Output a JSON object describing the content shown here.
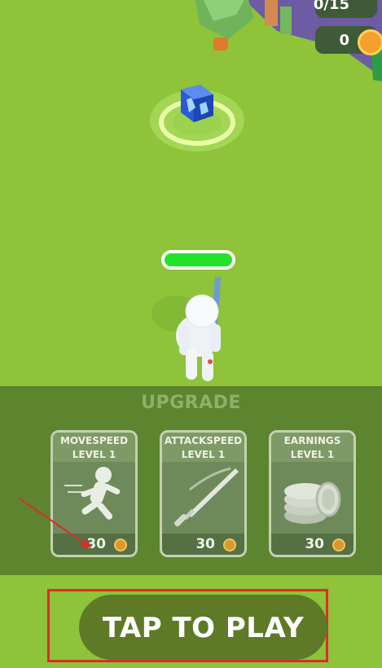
{
  "hud": {
    "kills": "0/15",
    "coins": "0"
  },
  "upgrade": {
    "title": "UPGRADE",
    "cards": [
      {
        "name": "MOVESPEED",
        "level": "LEVEL 1",
        "price": "30"
      },
      {
        "name": "ATTACKSPEED",
        "level": "LEVEL 1",
        "price": "30"
      },
      {
        "name": "EARNINGS",
        "level": "LEVEL 1",
        "price": "30"
      }
    ]
  },
  "play_button": {
    "label": "TAP TO PLAY"
  },
  "player": {
    "health_fraction": 1.0
  },
  "colors": {
    "grass": "#8ec33a",
    "panel": "#5d8530",
    "health": "#22e22a",
    "play_button": "#5e7a26",
    "highlight": "#e12a2a"
  }
}
